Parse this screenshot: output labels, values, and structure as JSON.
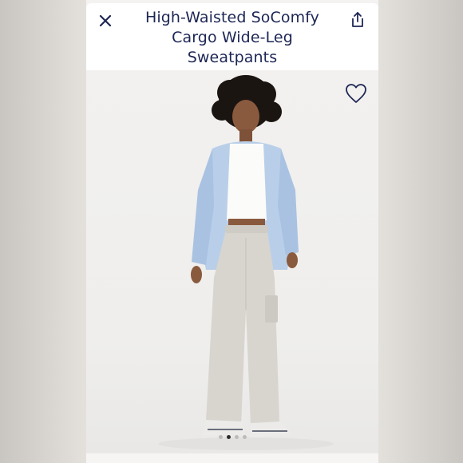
{
  "product": {
    "title_line1": "High-Waisted SoComfy",
    "title_line2": "Cargo Wide-Leg",
    "title_line3": "Sweatpants"
  },
  "header": {
    "close_icon": "close-icon",
    "share_icon": "share-icon"
  },
  "gallery": {
    "favorite_icon": "heart-icon",
    "image_count": 4,
    "active_index": 1
  },
  "colors": {
    "title": "#1d2654",
    "header_bg": "#ffffff",
    "photo_bg": "#f2f1ef"
  }
}
